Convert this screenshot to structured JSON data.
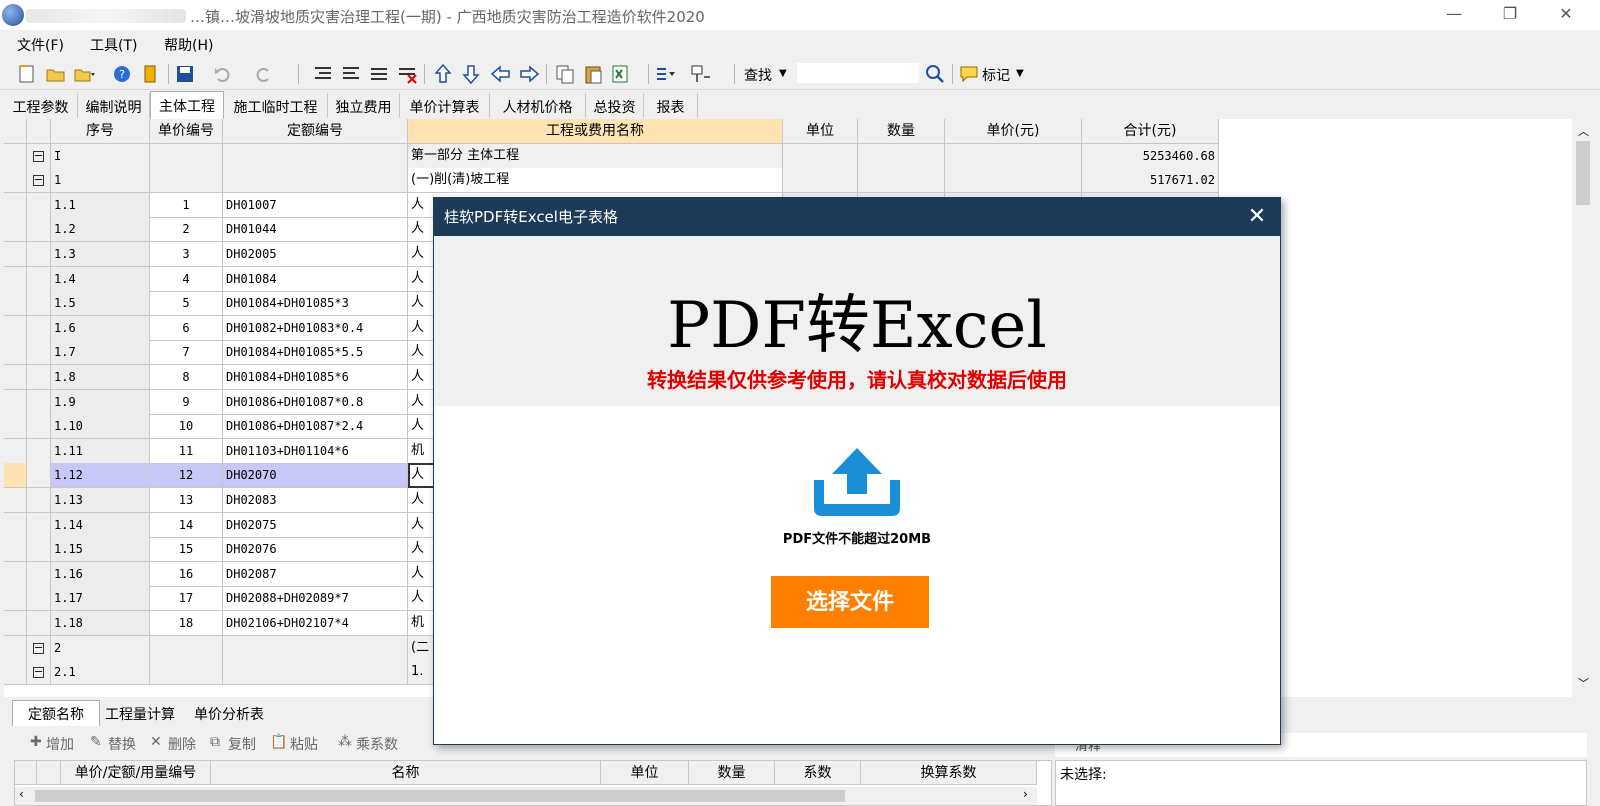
{
  "window": {
    "title": "广西地质灾害防治工程造价软件2020",
    "title_full": "…镇…坡滑坡地质灾害治理工程(一期) - 广西地质灾害防治工程造价软件2020",
    "minimize": "—",
    "maximize": "❐",
    "close": "✕"
  },
  "menu": [
    "文件(F)",
    "工具(T)",
    "帮助(H)"
  ],
  "toolbar": {
    "find_label": "查找",
    "mark_label": "标记",
    "search_value": ""
  },
  "tabs": [
    "工程参数",
    "编制说明",
    "主体工程",
    "施工临时工程",
    "独立费用",
    "单价计算表",
    "人材机价格",
    "总投资",
    "报表"
  ],
  "active_tab": "主体工程",
  "grid": {
    "headers": [
      "序号",
      "单价编号",
      "定额编号",
      "工程或费用名称",
      "单位",
      "数量",
      "单价(元)",
      "合计(元)"
    ],
    "rows": [
      {
        "seq": "I",
        "num": "",
        "code": "",
        "name": "第一部分 主体工程",
        "total": "5253460.68",
        "group": true,
        "expander": "⊟"
      },
      {
        "seq": "1",
        "num": "",
        "code": "",
        "name": "(一)削(清)坡工程",
        "total": "517671.02",
        "group": true,
        "expander": "⊟"
      },
      {
        "seq": "1.1",
        "num": "1",
        "code": "DH01007",
        "name": "人",
        "total": ""
      },
      {
        "seq": "1.2",
        "num": "2",
        "code": "DH01044",
        "name": "人",
        "total": ""
      },
      {
        "seq": "1.3",
        "num": "3",
        "code": "DH02005",
        "name": "人",
        "total": ""
      },
      {
        "seq": "1.4",
        "num": "4",
        "code": "DH01084",
        "name": "人",
        "total": ""
      },
      {
        "seq": "1.5",
        "num": "5",
        "code": "DH01084+DH01085*3",
        "name": "人",
        "total": ""
      },
      {
        "seq": "1.6",
        "num": "6",
        "code": "DH01082+DH01083*0.4",
        "name": "人",
        "total": ""
      },
      {
        "seq": "1.7",
        "num": "7",
        "code": "DH01084+DH01085*5.5",
        "name": "人",
        "total": ""
      },
      {
        "seq": "1.8",
        "num": "8",
        "code": "DH01084+DH01085*6",
        "name": "人",
        "total": ""
      },
      {
        "seq": "1.9",
        "num": "9",
        "code": "DH01086+DH01087*0.8",
        "name": "人",
        "total": ""
      },
      {
        "seq": "1.10",
        "num": "10",
        "code": "DH01086+DH01087*2.4",
        "name": "人",
        "total": ""
      },
      {
        "seq": "1.11",
        "num": "11",
        "code": "DH01103+DH01104*6",
        "name": "机",
        "total": ""
      },
      {
        "seq": "1.12",
        "num": "12",
        "code": "DH02070",
        "name": "人",
        "total": "",
        "selected": true
      },
      {
        "seq": "1.13",
        "num": "13",
        "code": "DH02083",
        "name": "人",
        "total": ""
      },
      {
        "seq": "1.14",
        "num": "14",
        "code": "DH02075",
        "name": "人",
        "total": ""
      },
      {
        "seq": "1.15",
        "num": "15",
        "code": "DH02076",
        "name": "人",
        "total": ""
      },
      {
        "seq": "1.16",
        "num": "16",
        "code": "DH02087",
        "name": "人",
        "total": ""
      },
      {
        "seq": "1.17",
        "num": "17",
        "code": "DH02088+DH02089*7",
        "name": "人",
        "total": ""
      },
      {
        "seq": "1.18",
        "num": "18",
        "code": "DH02106+DH02107*4",
        "name": "机",
        "total": ""
      },
      {
        "seq": "2",
        "num": "",
        "code": "",
        "name": "(二",
        "total": "",
        "group": true,
        "expander": "⊟"
      },
      {
        "seq": "2.1",
        "num": "",
        "code": "",
        "name": "1.",
        "total": "",
        "group": true,
        "expander": "⊟"
      }
    ]
  },
  "bottom": {
    "tabs": [
      "定额名称",
      "工程量计算",
      "单价分析表"
    ],
    "active_tab": "定额名称",
    "tools": [
      "增加",
      "替换",
      "删除",
      "复制",
      "粘贴",
      "乘系数"
    ],
    "headers": [
      "单价/定额/用量编号",
      "名称",
      "单位",
      "数量",
      "系数",
      "换算系数"
    ],
    "right_label": "未选择:",
    "right_tool": "清释"
  },
  "modal": {
    "title": "桂软PDF转Excel电子表格",
    "heading": "PDF转Excel",
    "warning": "转换结果仅供参考使用，请认真校对数据后使用",
    "limit": "PDF文件不能超过20MB",
    "button": "选择文件",
    "close": "✕"
  },
  "colors": {
    "modal_title_bg": "#1c3b59",
    "button_bg": "#ff8000",
    "warning_text": "#e00000",
    "selected_row": "#c8c8f8",
    "name_header": "#ffe3b3"
  }
}
